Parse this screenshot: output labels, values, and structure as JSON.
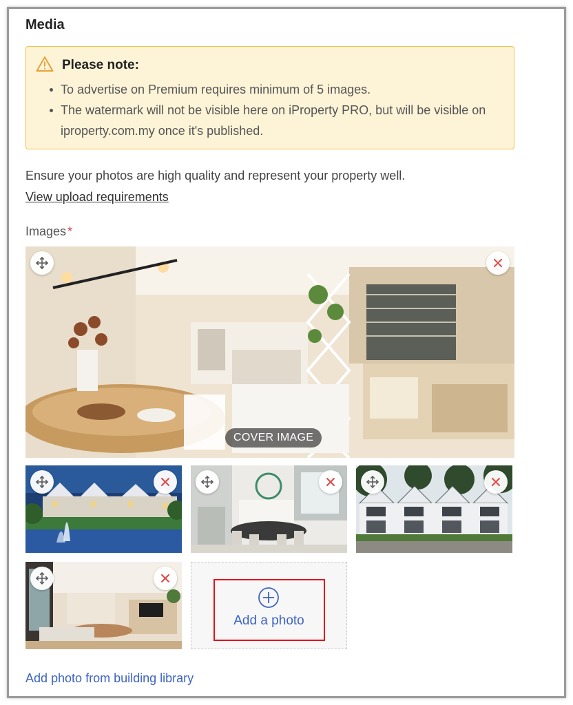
{
  "media": {
    "title": "Media",
    "note": {
      "title": "Please note:",
      "items": [
        "To advertise on Premium requires minimum of 5 images.",
        "The watermark will not be visible here on iProperty PRO, but will be visible on iproperty.com.my once it's published."
      ]
    },
    "description": "Ensure your photos are high quality and represent your property well.",
    "upload_requirements_link": "View upload requirements",
    "images_label": "Images",
    "required_marker": "*",
    "cover_badge": "COVER IMAGE",
    "images": [
      {
        "subject": "dining-kitchen-interior",
        "cover": true
      },
      {
        "subject": "lakeside-houses-fountain",
        "cover": false
      },
      {
        "subject": "double-volume-dining-hall",
        "cover": false
      },
      {
        "subject": "terrace-houses-exterior",
        "cover": false
      },
      {
        "subject": "living-room-interior",
        "cover": false
      }
    ],
    "add_photo_label": "Add a photo",
    "building_library_link": "Add photo from building library"
  },
  "colors": {
    "link": "#3d63c4",
    "note_bg": "#fdf3d7",
    "note_border": "#f3c34b",
    "remove_icon": "#e04848",
    "highlight_border": "#e0111b"
  }
}
